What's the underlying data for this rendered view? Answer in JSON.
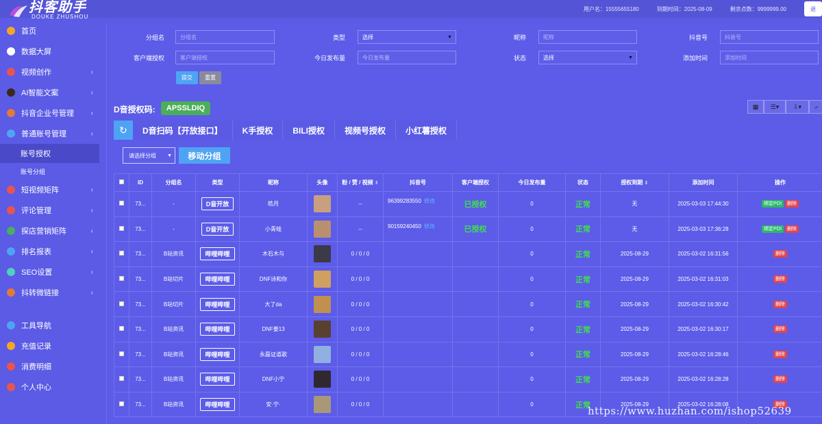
{
  "brand": {
    "title": "抖客助手",
    "subtitle": "DOUKE ZHUSHOU"
  },
  "topbar": {
    "username": "用户名：15555655180",
    "expire": "到期时间：2025-08-09",
    "points": "剩余点数：9999999.00",
    "btn": "退"
  },
  "sidebar": {
    "items": [
      {
        "label": "首页",
        "icon": "home-icon",
        "color": "#f5a623",
        "chev": ""
      },
      {
        "label": "数据大屏",
        "icon": "pie-chart-icon",
        "color": "#ffffff",
        "chev": ""
      },
      {
        "label": "视频创作",
        "icon": "video-icon",
        "color": "#e8554e",
        "chev": "‹"
      },
      {
        "label": "AI智能文案",
        "icon": "ai-icon",
        "color": "#3a2a1a",
        "chev": "‹"
      },
      {
        "label": "抖音企业号管理",
        "icon": "enterprise-icon",
        "color": "#e07b39",
        "chev": "‹"
      },
      {
        "label": "普通账号管理",
        "icon": "account-icon",
        "color": "#4fa3f4",
        "chev": "‹"
      }
    ],
    "sub_items": [
      {
        "label": "账号授权"
      },
      {
        "label": "账号分组"
      }
    ],
    "items2": [
      {
        "label": "短视频矩阵",
        "icon": "matrix-icon",
        "color": "#e8554e",
        "chev": "‹"
      },
      {
        "label": "评论管理",
        "icon": "comment-icon",
        "color": "#e8554e",
        "chev": "‹"
      },
      {
        "label": "探店营销矩阵",
        "icon": "store-icon",
        "color": "#4cae5a",
        "chev": "‹"
      },
      {
        "label": "排名报表",
        "icon": "rank-icon",
        "color": "#4fa3f4",
        "chev": "‹"
      },
      {
        "label": "SEO设置",
        "icon": "seo-icon",
        "color": "#4fd0c0",
        "chev": "‹"
      },
      {
        "label": "抖转微链接",
        "icon": "link-icon",
        "color": "#e07b39",
        "chev": "‹"
      }
    ],
    "items3": [
      {
        "label": "工具导航",
        "icon": "tools-icon",
        "color": "#4fa3f4"
      },
      {
        "label": "充值记录",
        "icon": "recharge-icon",
        "color": "#f5a623"
      },
      {
        "label": "消费明细",
        "icon": "consume-icon",
        "color": "#e8554e"
      },
      {
        "label": "个人中心",
        "icon": "user-icon",
        "color": "#e8554e"
      }
    ]
  },
  "filters": {
    "group": {
      "label": "分组名",
      "placeholder": "分组名"
    },
    "type": {
      "label": "类型",
      "value": "选择"
    },
    "nickname": {
      "label": "昵称",
      "placeholder": "昵称"
    },
    "douyin": {
      "label": "抖音号",
      "placeholder": "抖音号"
    },
    "client_auth": {
      "label": "客户端授权",
      "placeholder": "客户端授权"
    },
    "today_posts": {
      "label": "今日发布量",
      "placeholder": "今日发布量"
    },
    "status": {
      "label": "状态",
      "value": "选择"
    },
    "added": {
      "label": "添加时间",
      "placeholder": "添加时间"
    },
    "submit": "提交",
    "reset": "重置"
  },
  "auth": {
    "label": "D音授权码:",
    "code": "APSSLDIQ"
  },
  "tabs": [
    "D音扫码【开放接口】",
    "K手授权",
    "BILI授权",
    "视频号授权",
    "小红薯授权"
  ],
  "group_select": "请选择分组",
  "move_group": "移动分组",
  "table": {
    "headers": [
      "ID",
      "分组名",
      "类型",
      "昵称",
      "头像",
      "粉 / 赞 / 视频",
      "抖音号",
      "客户端授权",
      "今日发布量",
      "状态",
      "授权到期",
      "添加时间",
      "操作"
    ],
    "rows": [
      {
        "id": "73...",
        "group": "-",
        "type": "D音开放",
        "nickname": "皓月",
        "stats": "--",
        "douyin": "96399283550",
        "edit": "修改",
        "client": "已授权",
        "today": "0",
        "status": "正常",
        "expire": "无",
        "added": "2025-03-03 17:44:30",
        "poi": "绑定POI",
        "del": "删除",
        "avatar": "#c8a080"
      },
      {
        "id": "73...",
        "group": "-",
        "type": "D音开放",
        "nickname": "小青蛙",
        "stats": "--",
        "douyin": "90159240450",
        "edit": "修改",
        "client": "已授权",
        "today": "0",
        "status": "正常",
        "expire": "无",
        "added": "2025-03-03 17:36:28",
        "poi": "绑定POI",
        "del": "删除",
        "avatar": "#b89070"
      },
      {
        "id": "73...",
        "group": "B站资讯",
        "type": "哔哩哔哩",
        "nickname": "木石木与",
        "stats": "0 / 0 / 0",
        "douyin": "",
        "edit": "",
        "client": "",
        "today": "0",
        "status": "正常",
        "expire": "2025-08-29",
        "added": "2025-03-02 16:31:56",
        "poi": "",
        "del": "删除",
        "avatar": "#3a3a48"
      },
      {
        "id": "73...",
        "group": "B站切片",
        "type": "哔哩哔哩",
        "nickname": "DNF诗和你",
        "stats": "0 / 0 / 0",
        "douyin": "",
        "edit": "",
        "client": "",
        "today": "0",
        "status": "正常",
        "expire": "2025-08-29",
        "added": "2025-03-02 16:31:03",
        "poi": "",
        "del": "删除",
        "avatar": "#d0a060"
      },
      {
        "id": "73...",
        "group": "B站切片",
        "type": "哔哩哔哩",
        "nickname": "大了da",
        "stats": "0 / 0 / 0",
        "douyin": "",
        "edit": "",
        "client": "",
        "today": "0",
        "status": "正常",
        "expire": "2025-08-29",
        "added": "2025-03-02 16:30:42",
        "poi": "",
        "del": "删除",
        "avatar": "#c09050"
      },
      {
        "id": "73...",
        "group": "B站资讯",
        "type": "哔哩哔哩",
        "nickname": "DNF姜13",
        "stats": "0 / 0 / 0",
        "douyin": "",
        "edit": "",
        "client": "",
        "today": "0",
        "status": "正常",
        "expire": "2025-08-29",
        "added": "2025-03-02 16:30:17",
        "poi": "",
        "del": "删除",
        "avatar": "#5a4030"
      },
      {
        "id": "73...",
        "group": "B站资讯",
        "type": "哔哩哔哩",
        "nickname": "永磊证道歌",
        "stats": "0 / 0 / 0",
        "douyin": "",
        "edit": "",
        "client": "",
        "today": "0",
        "status": "正常",
        "expire": "2025-08-29",
        "added": "2025-03-02 16:28:46",
        "poi": "",
        "del": "删除",
        "avatar": "#8fb0e0"
      },
      {
        "id": "73...",
        "group": "B站资讯",
        "type": "哔哩哔哩",
        "nickname": "DNF小宁",
        "stats": "0 / 0 / 0",
        "douyin": "",
        "edit": "",
        "client": "",
        "today": "0",
        "status": "正常",
        "expire": "2025-08-29",
        "added": "2025-03-02 16:28:28",
        "poi": "",
        "del": "删除",
        "avatar": "#302830"
      },
      {
        "id": "73...",
        "group": "B站资讯",
        "type": "哔哩哔哩",
        "nickname": "安·宁·",
        "stats": "0 / 0 / 0",
        "douyin": "",
        "edit": "",
        "client": "",
        "today": "0",
        "status": "正常",
        "expire": "2025-08-29",
        "added": "2025-03-02 16:28:08",
        "poi": "",
        "del": "删除",
        "avatar": "#a89878"
      }
    ]
  },
  "watermark": "https://www.huzhan.com/ishop52639"
}
